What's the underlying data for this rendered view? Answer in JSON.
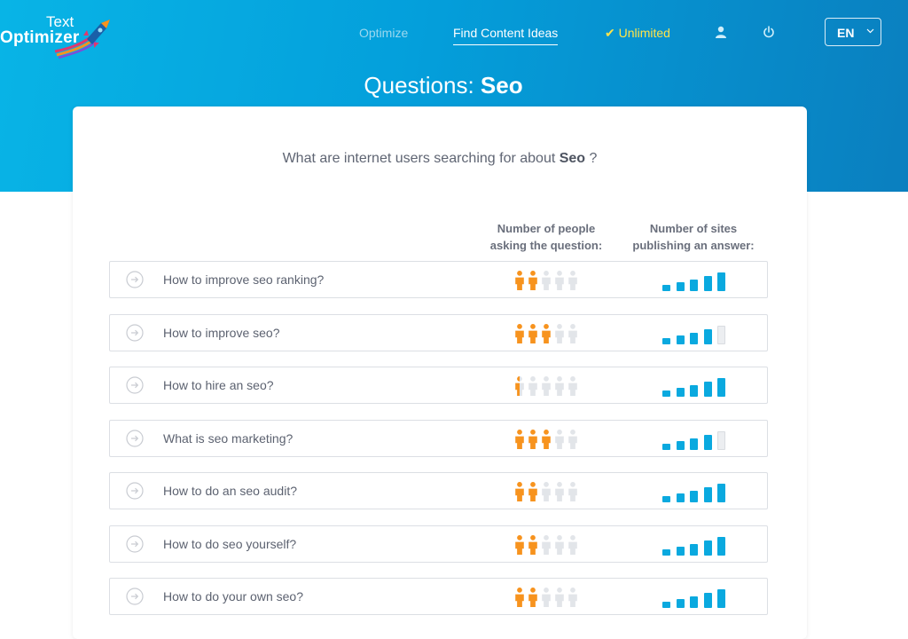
{
  "header": {
    "logo_line1": "Text",
    "logo_line2": "Optimizer",
    "nav": {
      "optimize": "Optimize",
      "find_ideas": "Find Content Ideas",
      "unlimited": "✔ Unlimited"
    },
    "user_icon": "user-icon",
    "power_icon": "power-icon",
    "language": "EN"
  },
  "title": {
    "prefix": "Questions: ",
    "keyword": "Seo"
  },
  "card": {
    "subtitle_prefix": "What are internet users searching for about ",
    "subtitle_keyword": "Seo",
    "subtitle_suffix": " ?",
    "col_people_line1": "Number of people",
    "col_people_line2": "asking the question:",
    "col_sites_line1": "Number of sites",
    "col_sites_line2": "publishing an answer:"
  },
  "colors": {
    "accent_orange": "#f7931e",
    "inactive_gray": "#e2e5e9",
    "bar_blue": "#0aa9df",
    "header_blue": "#049fdb"
  },
  "questions": [
    {
      "text": "How to improve seo ranking?",
      "people": 2,
      "sites": 5
    },
    {
      "text": "How to improve seo?",
      "people": 3,
      "sites": 4
    },
    {
      "text": "How to hire an seo?",
      "people": 0.5,
      "sites": 5
    },
    {
      "text": "What is seo marketing?",
      "people": 3,
      "sites": 4
    },
    {
      "text": "How to do an seo audit?",
      "people": 2,
      "sites": 5
    },
    {
      "text": "How to do seo yourself?",
      "people": 2,
      "sites": 5
    },
    {
      "text": "How to do your own seo?",
      "people": 2,
      "sites": 5
    }
  ]
}
